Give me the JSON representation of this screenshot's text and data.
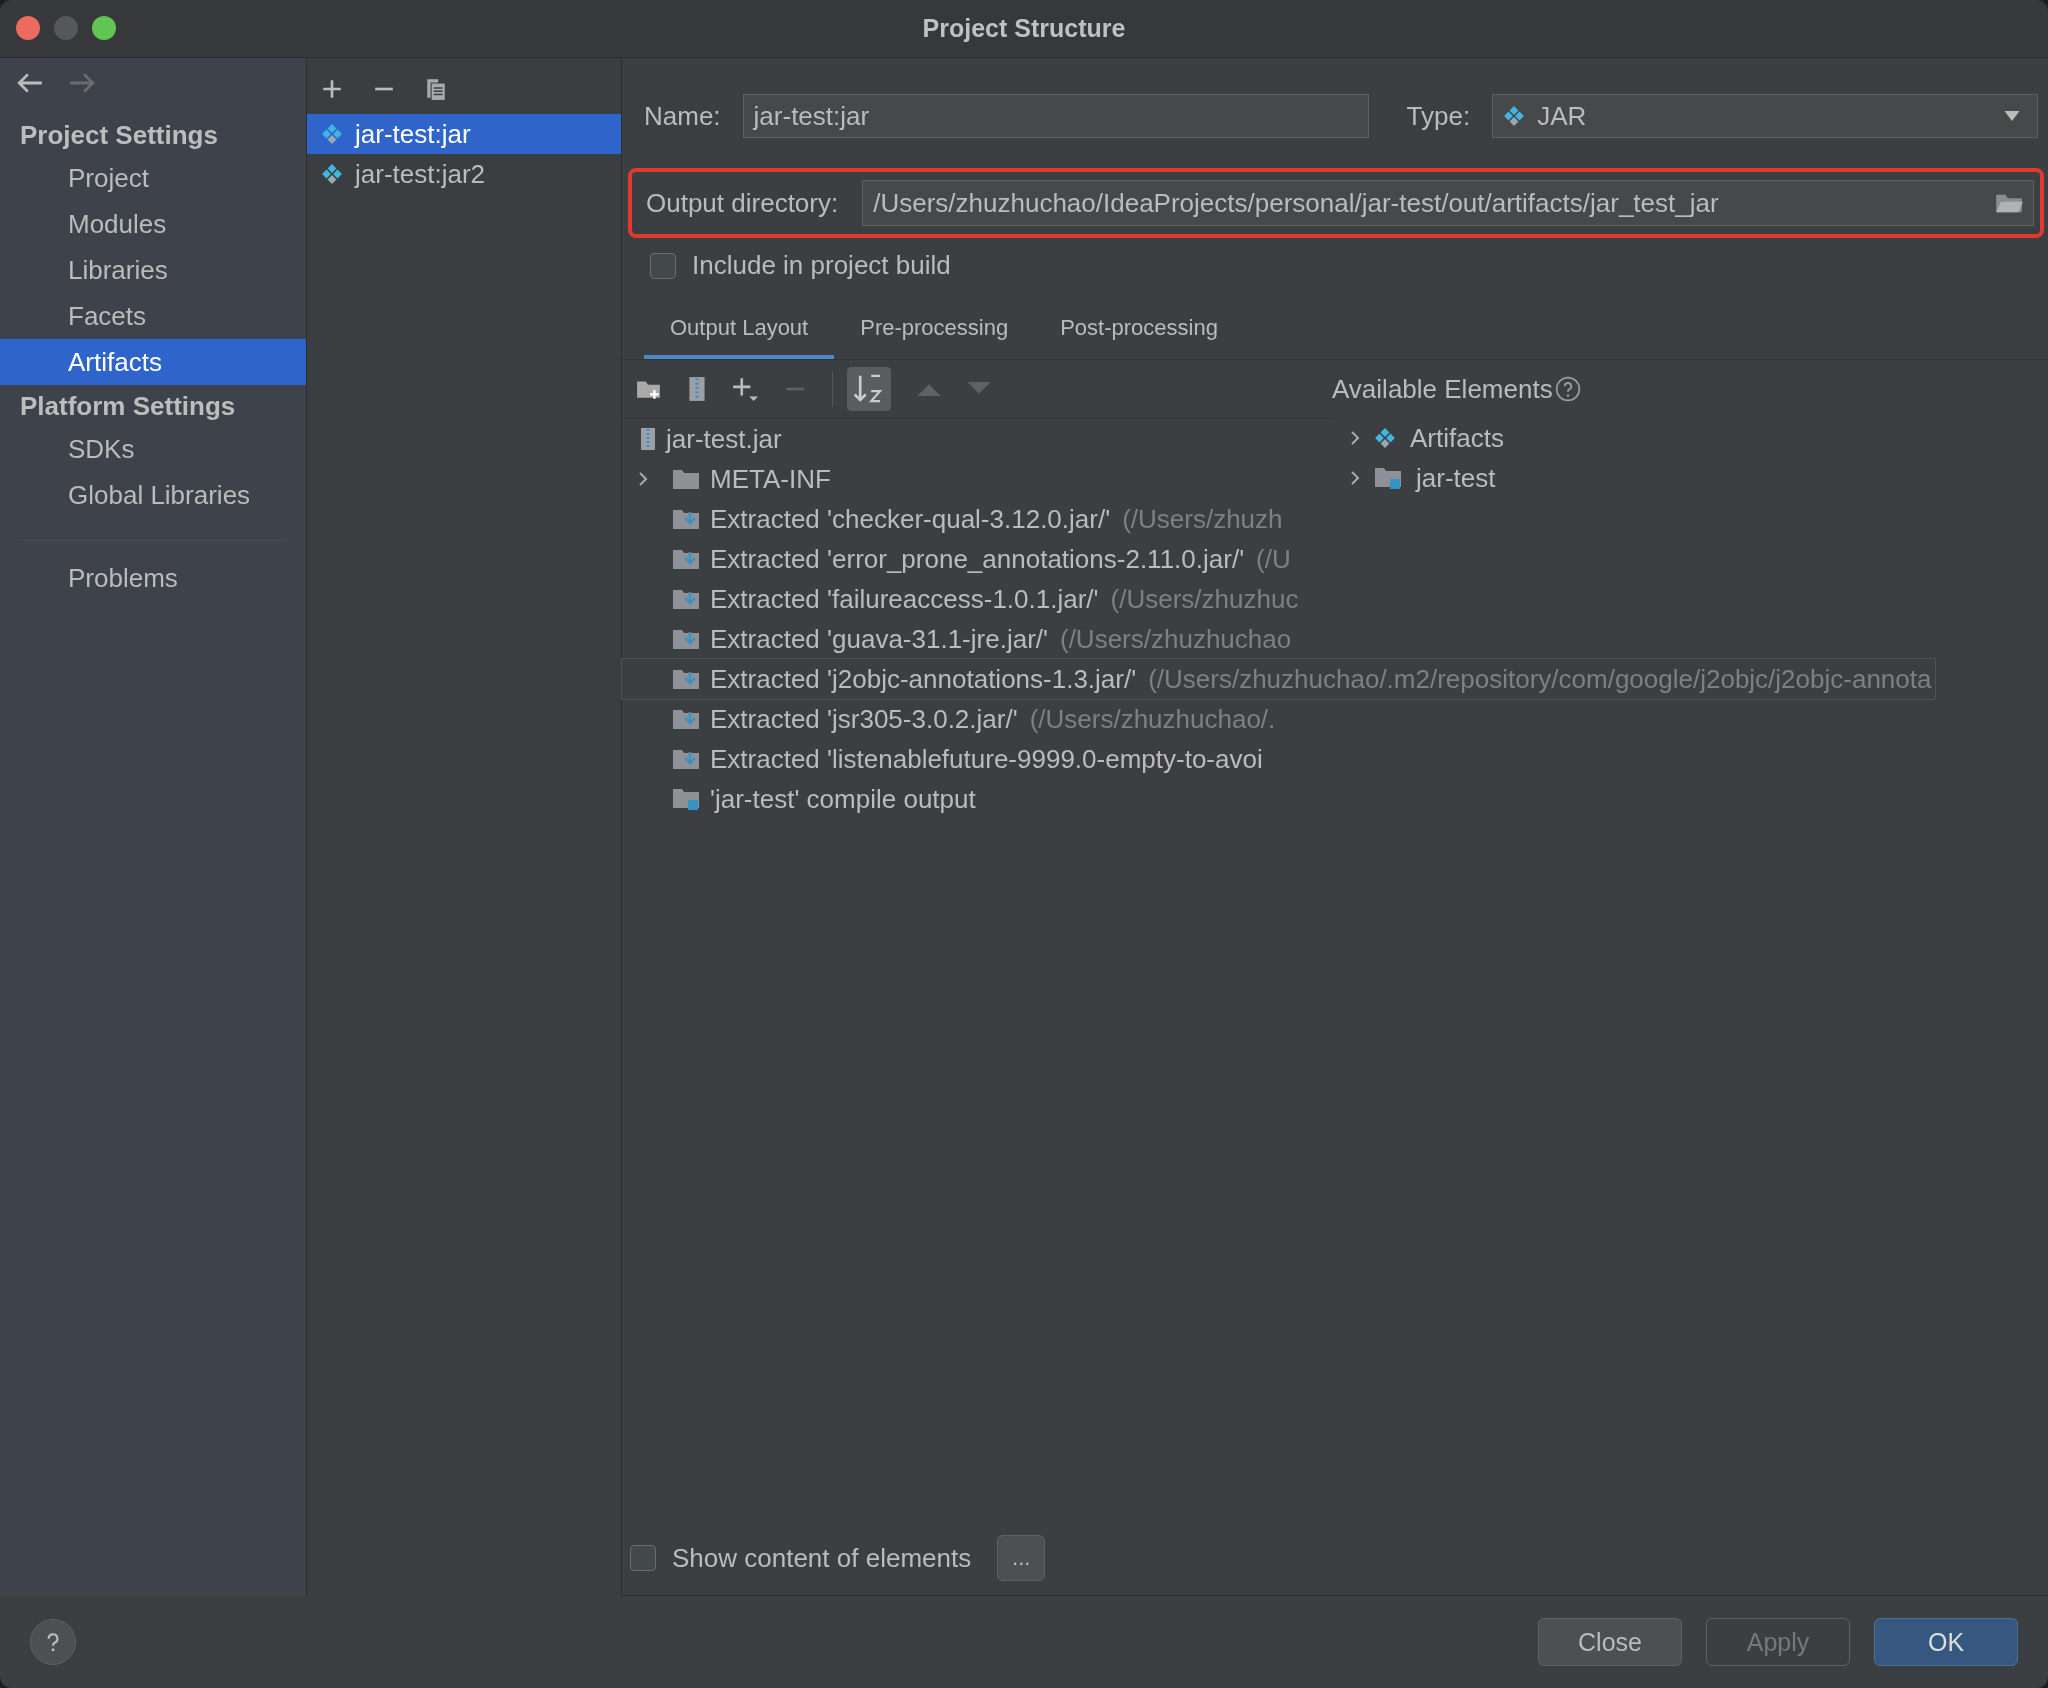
{
  "window": {
    "title": "Project Structure"
  },
  "sidebar": {
    "sections": [
      {
        "heading": "Project Settings",
        "items": [
          {
            "label": "Project",
            "selected": false
          },
          {
            "label": "Modules",
            "selected": false
          },
          {
            "label": "Libraries",
            "selected": false
          },
          {
            "label": "Facets",
            "selected": false
          },
          {
            "label": "Artifacts",
            "selected": true
          }
        ]
      },
      {
        "heading": "Platform Settings",
        "items": [
          {
            "label": "SDKs",
            "selected": false
          },
          {
            "label": "Global Libraries",
            "selected": false
          }
        ]
      }
    ],
    "extra_items": [
      {
        "label": "Problems",
        "selected": false
      }
    ]
  },
  "artifacts": [
    {
      "name": "jar-test:jar",
      "selected": true
    },
    {
      "name": "jar-test:jar2",
      "selected": false
    }
  ],
  "form": {
    "name_label": "Name:",
    "name_value": "jar-test:jar",
    "type_label": "Type:",
    "type_value": "JAR",
    "output_label": "Output directory:",
    "output_value": "/Users/zhuzhuchao/IdeaProjects/personal/jar-test/out/artifacts/jar_test_jar",
    "output_highlighted": true,
    "include": {
      "label": "Include in project build",
      "checked": false
    }
  },
  "tabs": [
    {
      "label": "Output Layout",
      "selected": true
    },
    {
      "label": "Pre-processing",
      "selected": false
    },
    {
      "label": "Post-processing",
      "selected": false
    }
  ],
  "layout_tree": {
    "root": "jar-test.jar",
    "rows": [
      {
        "kind": "folder",
        "label": "META-INF",
        "path": "",
        "hovered": false
      },
      {
        "kind": "extracted",
        "label": "Extracted 'checker-qual-3.12.0.jar/'",
        "path": "(/Users/zhuzh",
        "hovered": false
      },
      {
        "kind": "extracted",
        "label": "Extracted 'error_prone_annotations-2.11.0.jar/'",
        "path": "(/U",
        "hovered": false
      },
      {
        "kind": "extracted",
        "label": "Extracted 'failureaccess-1.0.1.jar/'",
        "path": "(/Users/zhuzhuc",
        "hovered": false
      },
      {
        "kind": "extracted",
        "label": "Extracted 'guava-31.1-jre.jar/'",
        "path": "(/Users/zhuzhuchao",
        "hovered": false
      },
      {
        "kind": "extracted",
        "label": "Extracted 'j2objc-annotations-1.3.jar/'",
        "path": "(/Users/zhuzhuchao/.m2/repository/com/google/j2objc/j2objc-annota",
        "hovered": true
      },
      {
        "kind": "extracted",
        "label": "Extracted 'jsr305-3.0.2.jar/'",
        "path": "(/Users/zhuzhuchao/.",
        "hovered": false
      },
      {
        "kind": "extracted",
        "label": "Extracted 'listenablefuture-9999.0-empty-to-avoi",
        "path": "",
        "hovered": false
      },
      {
        "kind": "module",
        "label": "'jar-test' compile output",
        "path": "",
        "hovered": false
      }
    ]
  },
  "available": {
    "title": "Available Elements",
    "items": [
      {
        "kind": "artifacts",
        "label": "Artifacts"
      },
      {
        "kind": "module",
        "label": "jar-test"
      }
    ]
  },
  "show_content": {
    "label": "Show content of elements",
    "checked": false
  },
  "more_button": "...",
  "buttons": [
    {
      "label": "Close",
      "kind": "normal"
    },
    {
      "label": "Apply",
      "kind": "disabled"
    },
    {
      "label": "OK",
      "kind": "primary"
    }
  ]
}
